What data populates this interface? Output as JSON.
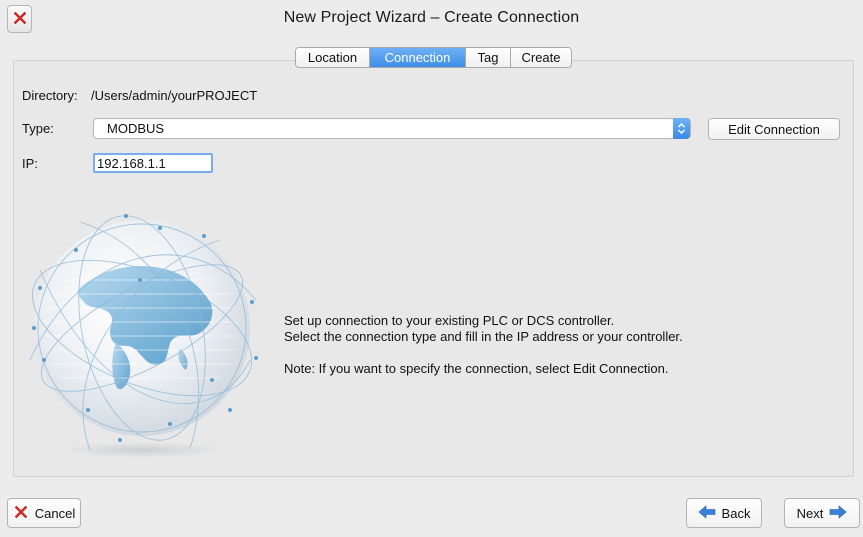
{
  "window": {
    "title": "New Project Wizard – Create Connection",
    "close_icon": "close-icon"
  },
  "tabs": [
    {
      "label": "Location",
      "active": false
    },
    {
      "label": "Connection",
      "active": true
    },
    {
      "label": "Tag",
      "active": false
    },
    {
      "label": "Create",
      "active": false
    }
  ],
  "form": {
    "directory_label": "Directory:",
    "directory_value": "/Users/admin/yourPROJECT",
    "type_label": "Type:",
    "type_value": "MODBUS",
    "edit_connection_label": "Edit Connection",
    "ip_label": "IP:",
    "ip_value": "192.168.1.1"
  },
  "info": {
    "line1": "Set up connection to your existing PLC or DCS controller.",
    "line2": "Select the connection type and fill in the IP address or your controller.",
    "note": "Note: If you want to specify the connection, select Edit Connection."
  },
  "footer": {
    "cancel_label": "Cancel",
    "back_label": "Back",
    "next_label": "Next"
  },
  "colors": {
    "accent": "#3e8ee8",
    "cancel_icon": "#d9302c",
    "arrow_icon": "#2f6fd0"
  }
}
